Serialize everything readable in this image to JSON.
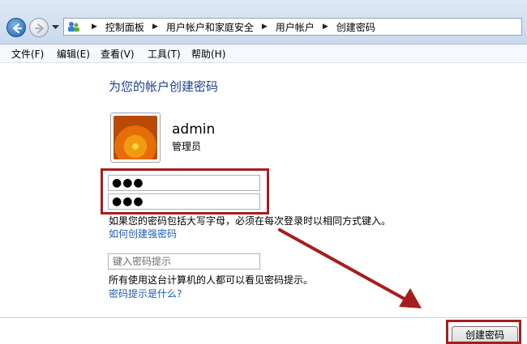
{
  "breadcrumb": {
    "items": [
      "控制面板",
      "用户帐户和家庭安全",
      "用户帐户",
      "创建密码"
    ],
    "separator": "▶"
  },
  "menubar": {
    "items": [
      "文件(F)",
      "编辑(E)",
      "查看(V)",
      "工具(T)",
      "帮助(H)"
    ]
  },
  "main": {
    "title": "为您的帐户创建密码",
    "user": {
      "name": "admin",
      "role": "管理员"
    },
    "password_value": "●●●",
    "confirm_value": "●●●",
    "caps_note": "如果您的密码包括大写字母，必须在每次登录时以相同方式键入。",
    "strong_link": "如何创建强密码",
    "hint_placeholder": "键入密码提示",
    "hint_note": "所有使用这台计算机的人都可以看见密码提示。",
    "hint_link": "密码提示是什么?",
    "create_button": "创建密码"
  },
  "colors": {
    "annotation_red": "#a51e1e",
    "link_blue": "#1a5cb8",
    "title_blue": "#1f3f8f"
  },
  "icons": [
    "back-arrow-icon",
    "forward-arrow-icon",
    "user-accounts-icon",
    "chevron-down-icon"
  ]
}
